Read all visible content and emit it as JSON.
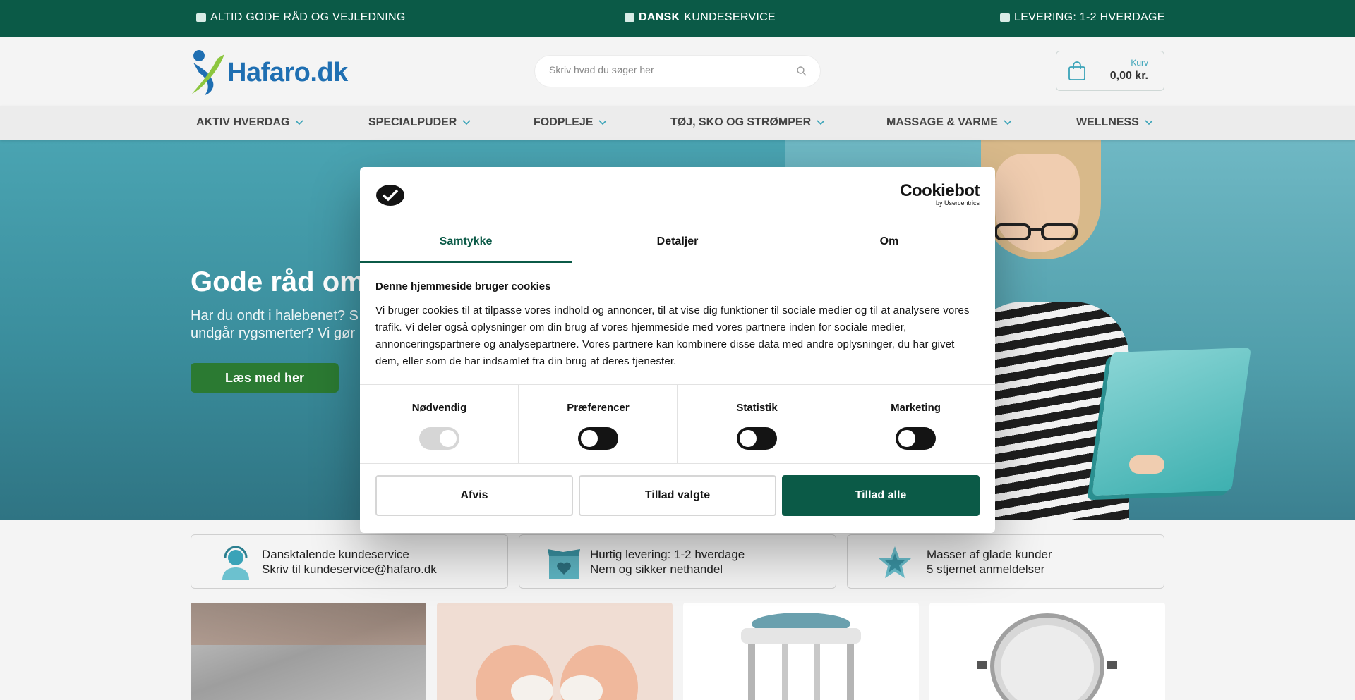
{
  "topbar": {
    "advice": "ALTID GODE RÅD OG VEJLEDNING",
    "service_bold": "DANSK",
    "service_rest": "KUNDESERVICE",
    "delivery": "LEVERING: 1-2 HVERDAGE"
  },
  "header": {
    "logo_text": "Hafaro.dk",
    "search_placeholder": "Skriv hvad du søger her",
    "cart_label": "Kurv",
    "cart_value": "0,00 kr."
  },
  "nav": {
    "items": [
      "AKTIV HVERDAG",
      "SPECIALPUDER",
      "FODPLEJE",
      "TØJ, SKO OG STRØMPER",
      "MASSAGE & VARME",
      "WELLNESS"
    ]
  },
  "hero": {
    "title": "Gode råd om",
    "text_line1": "Har du ondt i halebenet? S",
    "text_line2": "undgår rygsmerter? Vi gør",
    "button": "Læs med her"
  },
  "usps": [
    {
      "line1": "Dansktalende kundeservice",
      "line2": "Skriv til kundeservice@hafaro.dk",
      "icon": "support-agent-icon"
    },
    {
      "line1": "Hurtig levering: 1-2 hverdage",
      "line2": "Nem og sikker nethandel",
      "icon": "package-heart-icon"
    },
    {
      "line1": "Masser af glade kunder",
      "line2": "5 stjernet anmeldelser",
      "icon": "star-icon"
    }
  ],
  "cookie": {
    "brand": "Cookiebot",
    "brand_sub": "by Usercentrics",
    "tabs": [
      "Samtykke",
      "Detaljer",
      "Om"
    ],
    "active_tab": 0,
    "title": "Denne hjemmeside bruger cookies",
    "text": "Vi bruger cookies til at tilpasse vores indhold og annoncer, til at vise dig funktioner til sociale medier og til at analysere vores trafik. Vi deler også oplysninger om din brug af vores hjemmeside med vores partnere inden for sociale medier, annonceringspartnere og analysepartnere. Vores partnere kan kombinere disse data med andre oplysninger, du har givet dem, eller som de har indsamlet fra din brug af deres tjenester.",
    "categories": [
      {
        "name": "Nødvendig",
        "checked": true,
        "disabled": true
      },
      {
        "name": "Præferencer",
        "checked": false,
        "disabled": false
      },
      {
        "name": "Statistik",
        "checked": false,
        "disabled": false
      },
      {
        "name": "Marketing",
        "checked": false,
        "disabled": false
      }
    ],
    "buttons": {
      "deny": "Afvis",
      "allow_selected": "Tillad valgte",
      "allow_all": "Tillad alle"
    }
  },
  "colors": {
    "brand_green": "#0b5a47",
    "hero_button": "#2b7a32",
    "accent_teal": "#3aa3b8",
    "logo_blue": "#1f6fb2"
  }
}
